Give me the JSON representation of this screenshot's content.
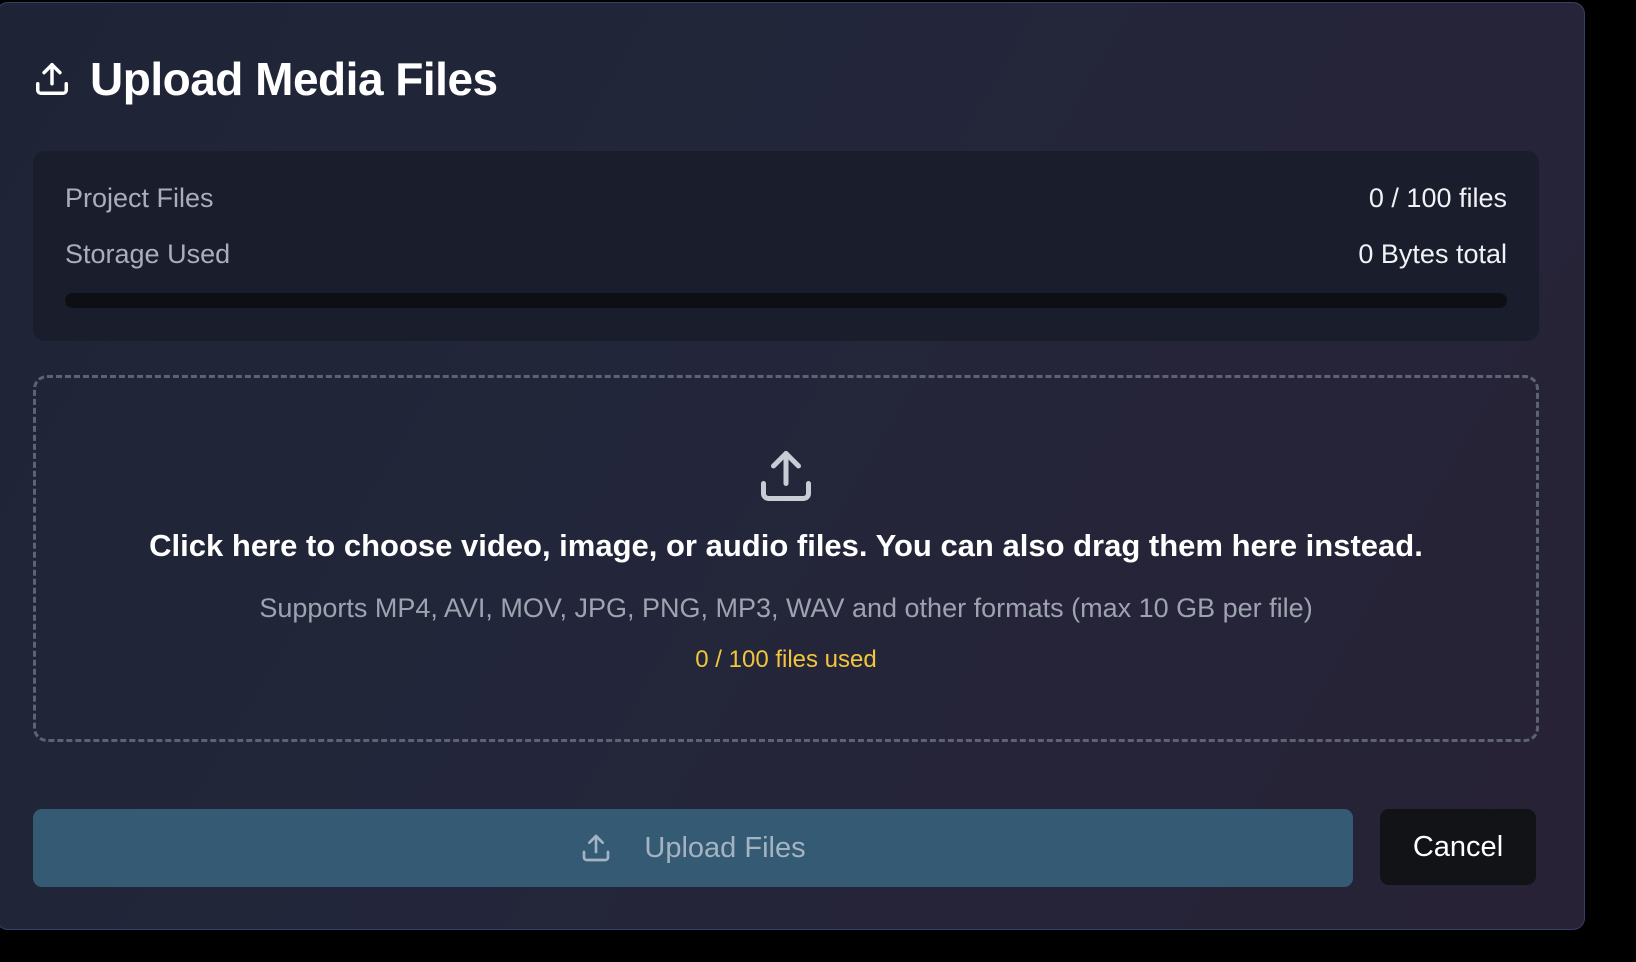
{
  "dialog": {
    "title": "Upload Media Files",
    "header_icon": "upload-icon"
  },
  "stats": {
    "project_files_label": "Project Files",
    "project_files_value": "0 / 100 files",
    "storage_label": "Storage Used",
    "storage_value": "0 Bytes total",
    "storage_progress": 0
  },
  "dropzone": {
    "icon": "upload-icon",
    "main_text": "Click here to choose video, image, or audio files. You can also drag them here instead.",
    "sub_text": "Supports MP4, AVI, MOV, JPG, PNG, MP3, WAV and other formats (max 10 GB per file)",
    "count_text": "0 / 100 files used"
  },
  "actions": {
    "upload_label": "Upload Files",
    "upload_icon": "upload-icon",
    "cancel_label": "Cancel"
  },
  "colors": {
    "background": "#000000",
    "panel": "#22263a",
    "card": "#1a1d2b",
    "accent_button": "#345a74",
    "count_highlight": "#f2c53d"
  }
}
